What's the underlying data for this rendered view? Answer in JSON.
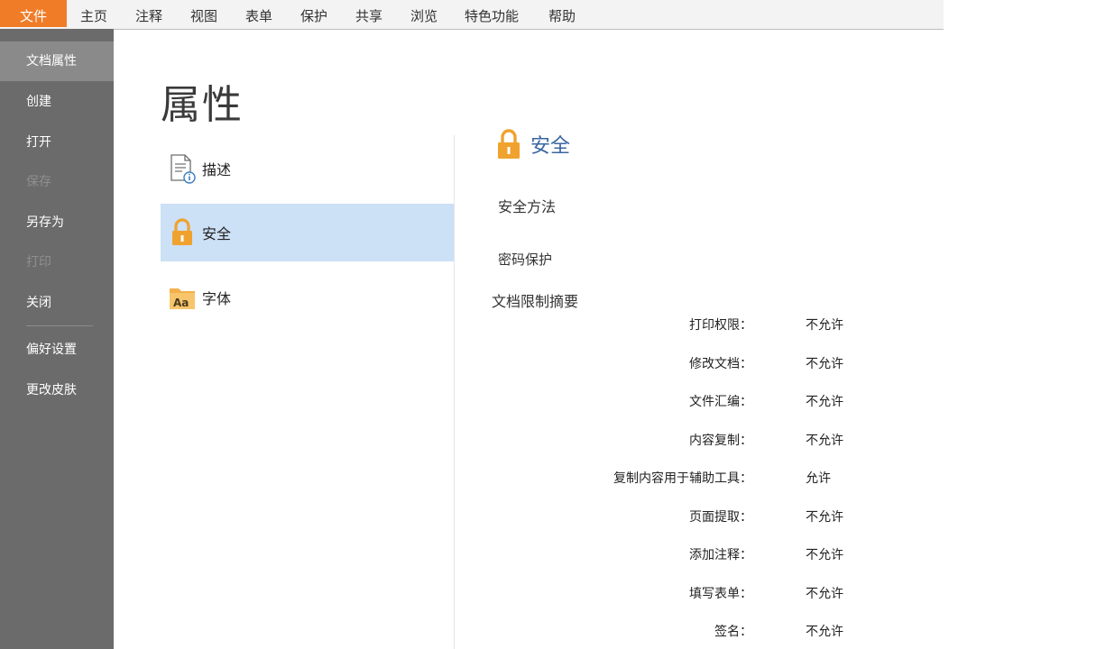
{
  "menu": [
    "文件",
    "主页",
    "注释",
    "视图",
    "表单",
    "保护",
    "共享",
    "浏览",
    "特色功能",
    "帮助"
  ],
  "sidebar": {
    "items": [
      {
        "label": "文档属性",
        "state": "active"
      },
      {
        "label": "创建",
        "state": "normal"
      },
      {
        "label": "打开",
        "state": "normal"
      },
      {
        "label": "保存",
        "state": "disabled"
      },
      {
        "label": "另存为",
        "state": "normal"
      },
      {
        "label": "打印",
        "state": "disabled"
      },
      {
        "label": "关闭",
        "state": "normal"
      },
      {
        "label": "偏好设置",
        "state": "normal"
      },
      {
        "label": "更改皮肤",
        "state": "normal"
      }
    ]
  },
  "page": {
    "title": "属性",
    "categories": [
      {
        "label": "描述",
        "icon": "description-doc-icon"
      },
      {
        "label": "安全",
        "icon": "lock-icon",
        "selected": true
      },
      {
        "label": "字体",
        "icon": "font-folder-icon"
      }
    ]
  },
  "security": {
    "title": "安全",
    "method_label": "安全方法",
    "method_value": "密码保护",
    "summary_label": "文档限制摘要",
    "permissions": [
      {
        "key": "打印权限：",
        "value": "不允许"
      },
      {
        "key": "修改文档：",
        "value": "不允许"
      },
      {
        "key": "文件汇编：",
        "value": "不允许"
      },
      {
        "key": "内容复制：",
        "value": "不允许"
      },
      {
        "key": "复制内容用于辅助工具：",
        "value": "允许"
      },
      {
        "key": "页面提取：",
        "value": "不允许"
      },
      {
        "key": "添加注释：",
        "value": "不允许"
      },
      {
        "key": "填写表单：",
        "value": "不允许"
      },
      {
        "key": "签名：",
        "value": "不允许"
      }
    ]
  },
  "colors": {
    "accent": "#f07c28",
    "sidebar": "#6b6b6b",
    "selection": "#cce0f6",
    "section_title": "#3a66a0",
    "lock": "#f0a22e"
  }
}
